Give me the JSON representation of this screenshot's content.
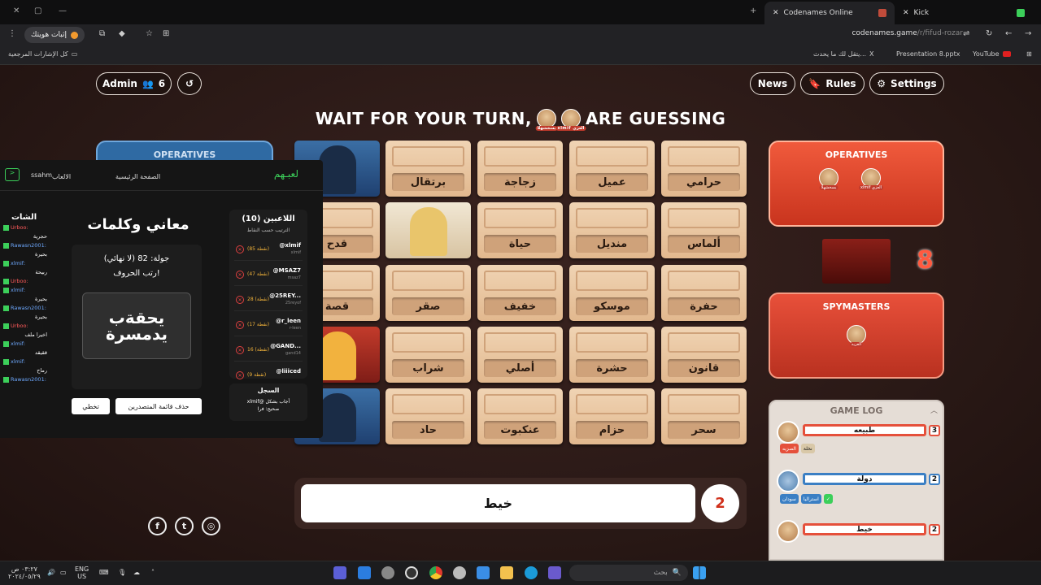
{
  "browser": {
    "tabs": [
      {
        "title": "Codenames Online",
        "active": true
      },
      {
        "title": "Kick",
        "active": false
      }
    ],
    "url_host": "codenames.game",
    "url_path": "/r/fifud-rozar",
    "profile_label": "إثبات هويتك",
    "bookmarks": [
      "كل الإشارات المرجعية",
      "يتقل لك ما يحدث...",
      "X",
      "Presentation 8.pptx",
      "YouTube"
    ]
  },
  "game": {
    "admin_label": "Admin",
    "players_count": "6",
    "news_label": "News",
    "rules_label": "Rules",
    "settings_label": "Settings",
    "banner_left": "WAIT FOR YOUR TURN,",
    "banner_right": "ARE GUESSING",
    "banner_guessers": [
      "يسخشهلا",
      "xlmif العزي"
    ],
    "blue_operatives_label": "OPERATIVES",
    "red_operatives_label": "OPERATIVES",
    "red_operatives": [
      "يسخشهلا",
      "xlmif العزي"
    ],
    "red_spymasters_label": "SPYMASTERS",
    "red_spymaster": "العزيه",
    "red_score": "8",
    "cards": [
      [
        "",
        "برتقال",
        "زجاجة",
        "عميل",
        "حرامي"
      ],
      [
        "قدح",
        "",
        "حياة",
        "منديل",
        "ألماس"
      ],
      [
        "قصة",
        "صقر",
        "خفيف",
        "موسكو",
        "حفرة"
      ],
      [
        "",
        "شراب",
        "أصلي",
        "حشرة",
        "قانون"
      ],
      [
        "",
        "حاد",
        "عنكبوت",
        "حزام",
        "سحر"
      ]
    ],
    "clue_word": "خيط",
    "clue_number": "2",
    "game_log_label": "GAME LOG",
    "log": [
      {
        "player": "العزيه",
        "word": "طبيعه",
        "num": "3",
        "guesses": [
          "الصزيه",
          "نخلة"
        ]
      },
      {
        "player": "سفرة",
        "word": "دولة",
        "num": "2",
        "guesses": [
          "سودان",
          "استراليا"
        ]
      },
      {
        "player": "العزيه",
        "word": "خيط",
        "num": "2"
      }
    ]
  },
  "overlay": {
    "nav_home": "الصفحة الرئيسية",
    "nav_games": "الالعاب",
    "nav_user": "ssahm",
    "logo": "لعبـهم",
    "chat_title": "الشات",
    "chat": [
      {
        "user": "Urboo:",
        "color": "r",
        "msg": "حجرية"
      },
      {
        "user": "Rawasn2001:",
        "color": "u",
        "msg": "بحيرة"
      },
      {
        "user": "xlmif:",
        "color": "u",
        "msg": "ربيحة"
      },
      {
        "user": "Urboo:",
        "color": "r",
        "msg": ""
      },
      {
        "user": "xlmif:",
        "color": "u",
        "msg": "بحيرة"
      },
      {
        "user": "Rawasn2001:",
        "color": "u",
        "msg": "بحيرة"
      },
      {
        "user": "Urboo:",
        "color": "r",
        "msg": "اخيرا ملف"
      },
      {
        "user": "xlmif:",
        "color": "u",
        "msg": "ققيقد"
      },
      {
        "user": "xlmif:",
        "color": "u",
        "msg": "رماح"
      },
      {
        "user": "Rawasn2001:",
        "color": "u",
        "msg": ""
      }
    ],
    "game_title": "معاني وكلمات",
    "round_text": "جولة: 82 (لا نهائي)",
    "instruction": "رتب الحروف!",
    "scrambled_line1": "يحقةب",
    "scrambled_line2": "يدمسرة",
    "btn_skip": "تخطي",
    "btn_clear": "حذف قائمة المتصدرين",
    "players_title": "اللاعبين (10)",
    "players_sub": "الترتيب حسب النقاط",
    "players": [
      {
        "name": "@xlmif",
        "sub": "xlmif",
        "pts": "(85 نقطة)"
      },
      {
        "name": "@MSAZ7",
        "sub": "msaz7",
        "pts": "(47 نقطة)"
      },
      {
        "name": "@25REY...",
        "sub": "25reyof",
        "pts": "28 (نقطة)"
      },
      {
        "name": "@r_leen",
        "sub": "r-leen",
        "pts": "(17 نقطة)"
      },
      {
        "name": "@GAND...",
        "sub": "gand14",
        "pts": "16 (نقطة)"
      },
      {
        "name": "@liiiced",
        "sub": "",
        "pts": "(9 نقطة)"
      }
    ],
    "log_title": "السجل",
    "log_line1": "xlmif@ أجاب بشكل",
    "log_line2": "صحيح: فرا"
  },
  "taskbar": {
    "search": "بحث",
    "lang1": "ENG",
    "lang2": "US",
    "time": "٠٣:٢٧ ص",
    "date": "٢٠٢٤/٠٥/٢٩"
  },
  "colors": {
    "red_team": "#d9412b",
    "blue_team": "#2f6aa3",
    "card_beige": "#ecc9a3"
  }
}
